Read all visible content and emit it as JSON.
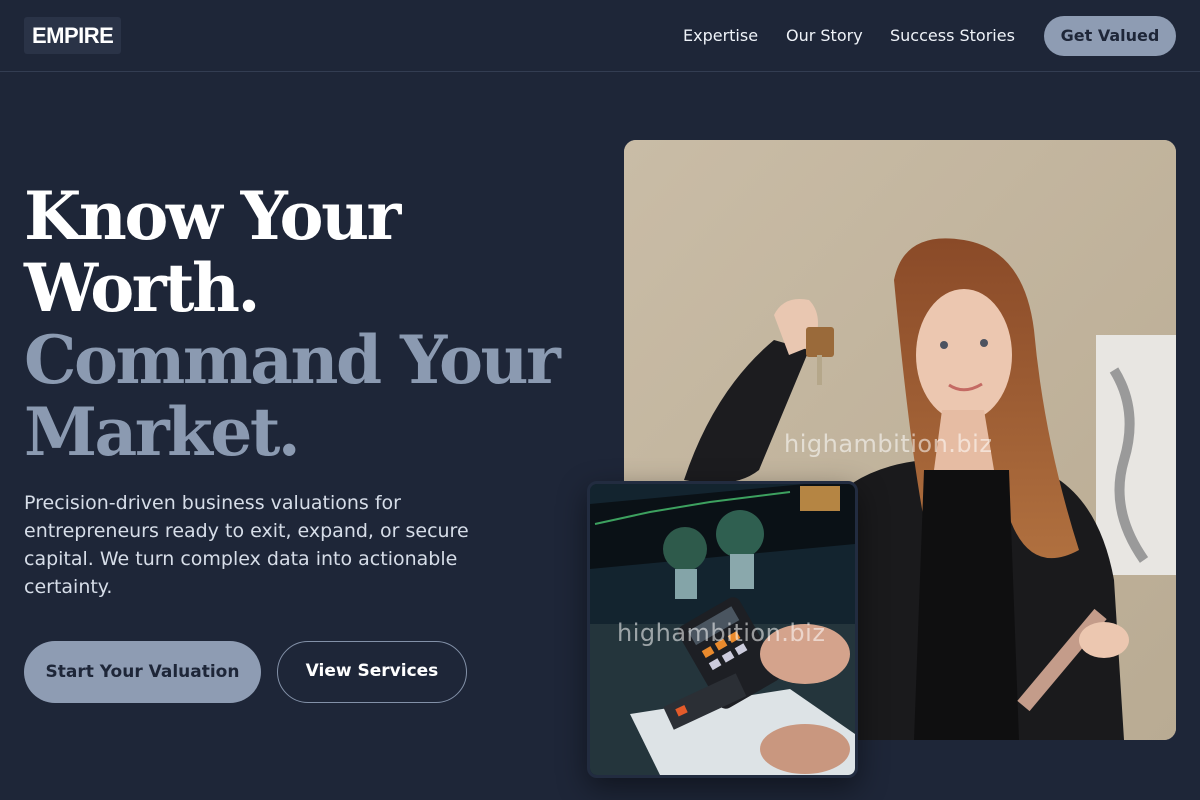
{
  "brand": {
    "logo": "EMPIRE"
  },
  "nav": {
    "links": [
      "Expertise",
      "Our Story",
      "Success Stories"
    ],
    "cta": "Get Valued"
  },
  "hero": {
    "headline_line1": "Know Your",
    "headline_line2": "Worth.",
    "headline_line3": "Command Your",
    "headline_line4": "Market.",
    "description": "Precision-driven business valuations for entrepreneurs ready to exit, expand, or secure capital. We turn complex data into actionable certainty.",
    "primary_button": "Start Your Valuation",
    "secondary_button": "View Services"
  },
  "images": {
    "main_photo_alt": "Woman holding house keys and a tablet",
    "small_photo_alt": "Person using a calculator at a desk with a monitor",
    "watermark": "highambition.biz"
  },
  "colors": {
    "background": "#1e2638",
    "accent": "#8e9cb3",
    "headline_muted": "#8b9ab1",
    "text_light": "#d6dde8"
  }
}
